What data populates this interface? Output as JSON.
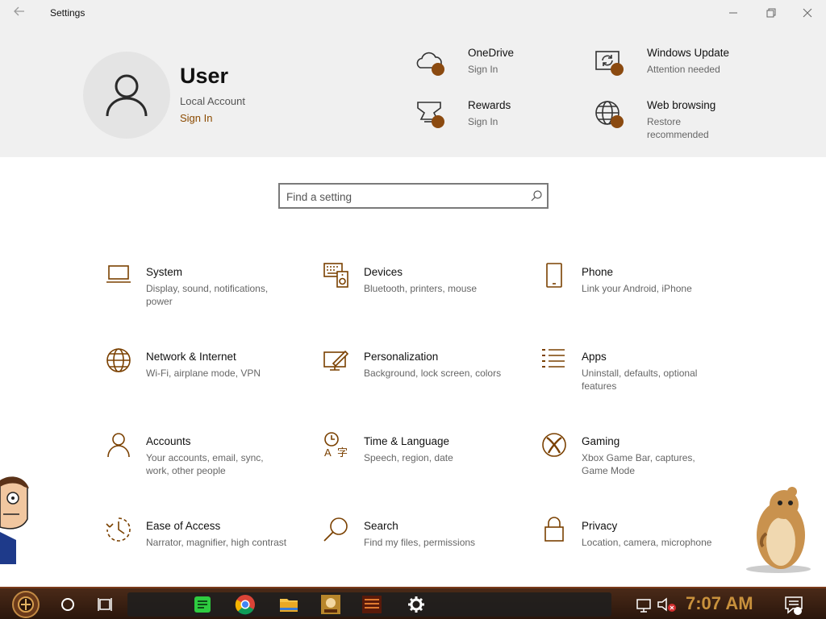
{
  "window": {
    "title": "Settings",
    "back_icon": "back-arrow-icon",
    "controls": [
      "minimize-icon",
      "maximize-icon",
      "close-icon"
    ]
  },
  "accent_color": "#7a4000",
  "badge_color": "#8b4a10",
  "profile": {
    "name": "User",
    "account_type": "Local Account",
    "sign_in_label": "Sign In"
  },
  "services": [
    {
      "title": "OneDrive",
      "subtitle": "Sign In",
      "icon": "cloud-icon"
    },
    {
      "title": "Rewards",
      "subtitle": "Sign In",
      "icon": "trophy-icon"
    },
    {
      "title": "Windows Update",
      "subtitle": "Attention needed",
      "icon": "sync-icon"
    },
    {
      "title": "Web browsing",
      "subtitle": "Restore recommended",
      "icon": "globe-icon"
    }
  ],
  "search": {
    "placeholder": "Find a setting"
  },
  "categories": [
    {
      "title": "System",
      "desc": "Display, sound, notifications, power",
      "icon": "laptop-icon"
    },
    {
      "title": "Devices",
      "desc": "Bluetooth, printers, mouse",
      "icon": "keyboard-speaker-icon"
    },
    {
      "title": "Phone",
      "desc": "Link your Android, iPhone",
      "icon": "phone-icon"
    },
    {
      "title": "Network & Internet",
      "desc": "Wi-Fi, airplane mode, VPN",
      "icon": "globe-icon"
    },
    {
      "title": "Personalization",
      "desc": "Background, lock screen, colors",
      "icon": "paintbrush-icon"
    },
    {
      "title": "Apps",
      "desc": "Uninstall, defaults, optional features",
      "icon": "list-icon"
    },
    {
      "title": "Accounts",
      "desc": "Your accounts, email, sync, work, other people",
      "icon": "person-icon"
    },
    {
      "title": "Time & Language",
      "desc": "Speech, region, date",
      "icon": "time-language-icon"
    },
    {
      "title": "Gaming",
      "desc": "Xbox Game Bar, captures, Game Mode",
      "icon": "xbox-icon"
    },
    {
      "title": "Ease of Access",
      "desc": "Narrator, magnifier, high contrast",
      "icon": "ease-of-access-icon"
    },
    {
      "title": "Search",
      "desc": "Find my files, permissions",
      "icon": "search-icon"
    },
    {
      "title": "Privacy",
      "desc": "Location, camera, microphone",
      "icon": "lock-icon"
    }
  ],
  "taskbar": {
    "clock": "7:07 AM",
    "apps": [
      "start-icon",
      "cortana-icon",
      "task-view-icon",
      "spotify-icon",
      "chrome-icon",
      "file-explorer-icon",
      "game-icon",
      "game-icon",
      "settings-gear-icon"
    ],
    "tray": [
      "network-icon",
      "volume-muted-icon",
      "action-center-icon"
    ]
  }
}
